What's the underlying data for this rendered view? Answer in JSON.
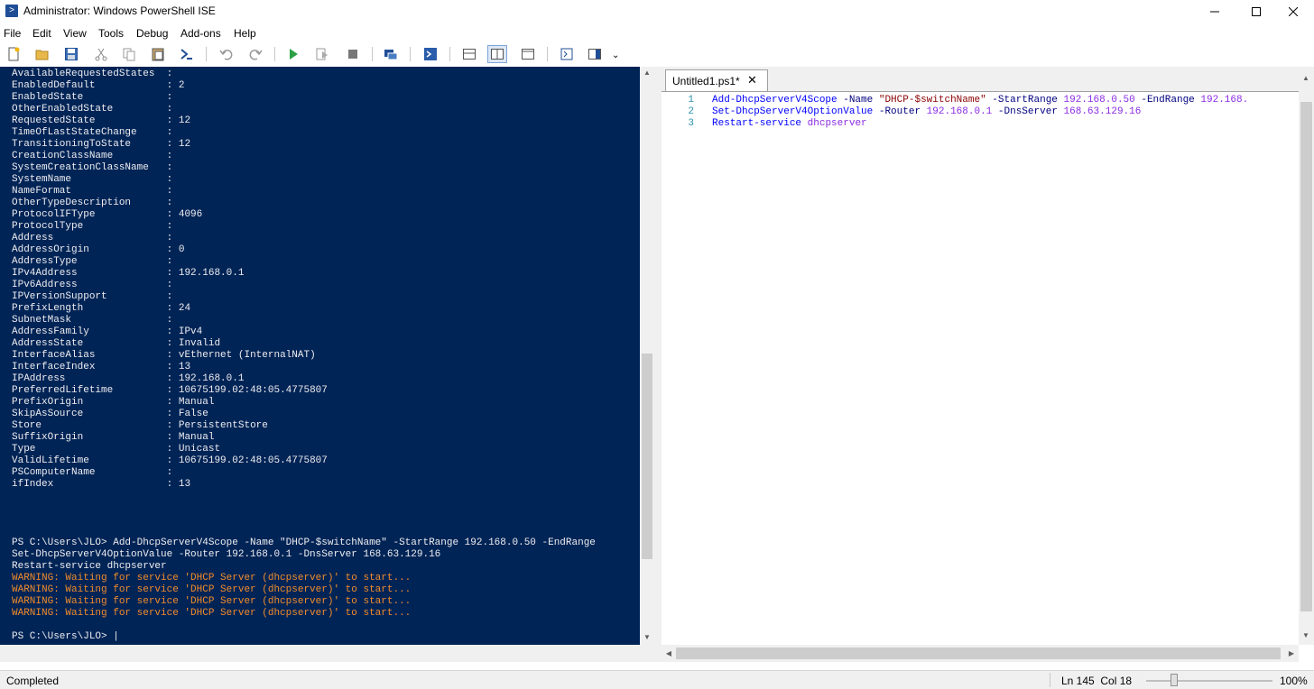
{
  "window": {
    "title": "Administrator: Windows PowerShell ISE",
    "minimize_glyph": "—",
    "maximize_glyph": "☐",
    "close_glyph": "✕"
  },
  "menu": [
    "File",
    "Edit",
    "View",
    "Tools",
    "Debug",
    "Add-ons",
    "Help"
  ],
  "toolbar": {
    "icons": [
      "new-file-icon",
      "open-folder-icon",
      "save-icon",
      "cut-icon",
      "copy-icon",
      "paste-icon",
      "powershell-icon",
      "undo-icon",
      "redo-icon",
      "run-script-icon",
      "run-selection-icon",
      "stop-icon",
      "remote-powershell-icon",
      "start-powershell-exe-icon",
      "show-script-pane-top-icon",
      "show-script-pane-right-icon",
      "show-script-pane-maximized-icon",
      "show-command-window-icon",
      "show-command-addon-icon"
    ],
    "overflow_glyph": "⌄"
  },
  "console": {
    "properties": [
      {
        "name": "AvailableRequestedStates",
        "value": ""
      },
      {
        "name": "EnabledDefault",
        "value": "2"
      },
      {
        "name": "EnabledState",
        "value": ""
      },
      {
        "name": "OtherEnabledState",
        "value": ""
      },
      {
        "name": "RequestedState",
        "value": "12"
      },
      {
        "name": "TimeOfLastStateChange",
        "value": ""
      },
      {
        "name": "TransitioningToState",
        "value": "12"
      },
      {
        "name": "CreationClassName",
        "value": ""
      },
      {
        "name": "SystemCreationClassName",
        "value": ""
      },
      {
        "name": "SystemName",
        "value": ""
      },
      {
        "name": "NameFormat",
        "value": ""
      },
      {
        "name": "OtherTypeDescription",
        "value": ""
      },
      {
        "name": "ProtocolIFType",
        "value": "4096"
      },
      {
        "name": "ProtocolType",
        "value": ""
      },
      {
        "name": "Address",
        "value": ""
      },
      {
        "name": "AddressOrigin",
        "value": "0"
      },
      {
        "name": "AddressType",
        "value": ""
      },
      {
        "name": "IPv4Address",
        "value": "192.168.0.1"
      },
      {
        "name": "IPv6Address",
        "value": ""
      },
      {
        "name": "IPVersionSupport",
        "value": ""
      },
      {
        "name": "PrefixLength",
        "value": "24"
      },
      {
        "name": "SubnetMask",
        "value": ""
      },
      {
        "name": "AddressFamily",
        "value": "IPv4"
      },
      {
        "name": "AddressState",
        "value": "Invalid"
      },
      {
        "name": "InterfaceAlias",
        "value": "vEthernet (InternalNAT)"
      },
      {
        "name": "InterfaceIndex",
        "value": "13"
      },
      {
        "name": "IPAddress",
        "value": "192.168.0.1"
      },
      {
        "name": "PreferredLifetime",
        "value": "10675199.02:48:05.4775807"
      },
      {
        "name": "PrefixOrigin",
        "value": "Manual"
      },
      {
        "name": "SkipAsSource",
        "value": "False"
      },
      {
        "name": "Store",
        "value": "PersistentStore"
      },
      {
        "name": "SuffixOrigin",
        "value": "Manual"
      },
      {
        "name": "Type",
        "value": "Unicast"
      },
      {
        "name": "ValidLifetime",
        "value": "10675199.02:48:05.4775807"
      },
      {
        "name": "PSComputerName",
        "value": ""
      },
      {
        "name": "ifIndex",
        "value": "13"
      }
    ],
    "command_lines": [
      "PS C:\\Users\\JLO> Add-DhcpServerV4Scope -Name \"DHCP-$switchName\" -StartRange 192.168.0.50 -EndRange",
      "Set-DhcpServerV4OptionValue -Router 192.168.0.1 -DnsServer 168.63.129.16",
      "Restart-service dhcpserver"
    ],
    "warnings": [
      "WARNING: Waiting for service 'DHCP Server (dhcpserver)' to start...",
      "WARNING: Waiting for service 'DHCP Server (dhcpserver)' to start...",
      "WARNING: Waiting for service 'DHCP Server (dhcpserver)' to start...",
      "WARNING: Waiting for service 'DHCP Server (dhcpserver)' to start..."
    ],
    "prompt": "PS C:\\Users\\JLO> |"
  },
  "editor": {
    "tab_label": "Untitled1.ps1*",
    "tab_close": "✕",
    "line_numbers": [
      "1",
      "2",
      "3"
    ],
    "lines": [
      [
        {
          "t": "Add-DhcpServerV4Scope",
          "c": "cmd"
        },
        {
          "t": " "
        },
        {
          "t": "-Name",
          "c": "param"
        },
        {
          "t": " "
        },
        {
          "t": "\"DHCP-$switchName\"",
          "c": "str"
        },
        {
          "t": " "
        },
        {
          "t": "-StartRange",
          "c": "param"
        },
        {
          "t": " "
        },
        {
          "t": "192.168.0.50",
          "c": "arg"
        },
        {
          "t": " "
        },
        {
          "t": "-EndRange",
          "c": "param"
        },
        {
          "t": " "
        },
        {
          "t": "192.168.",
          "c": "arg"
        }
      ],
      [
        {
          "t": "Set-DhcpServerV4OptionValue",
          "c": "cmd"
        },
        {
          "t": " "
        },
        {
          "t": "-Router",
          "c": "param"
        },
        {
          "t": " "
        },
        {
          "t": "192.168.0.1",
          "c": "arg"
        },
        {
          "t": " "
        },
        {
          "t": "-DnsServer",
          "c": "param"
        },
        {
          "t": " "
        },
        {
          "t": "168.63.129.16",
          "c": "arg"
        }
      ],
      [
        {
          "t": "Restart-service",
          "c": "cmd"
        },
        {
          "t": " "
        },
        {
          "t": "dhcpserver",
          "c": "arg"
        }
      ]
    ]
  },
  "status": {
    "text": "Completed",
    "position": "Ln 145  Col 18",
    "zoom": "100%"
  }
}
